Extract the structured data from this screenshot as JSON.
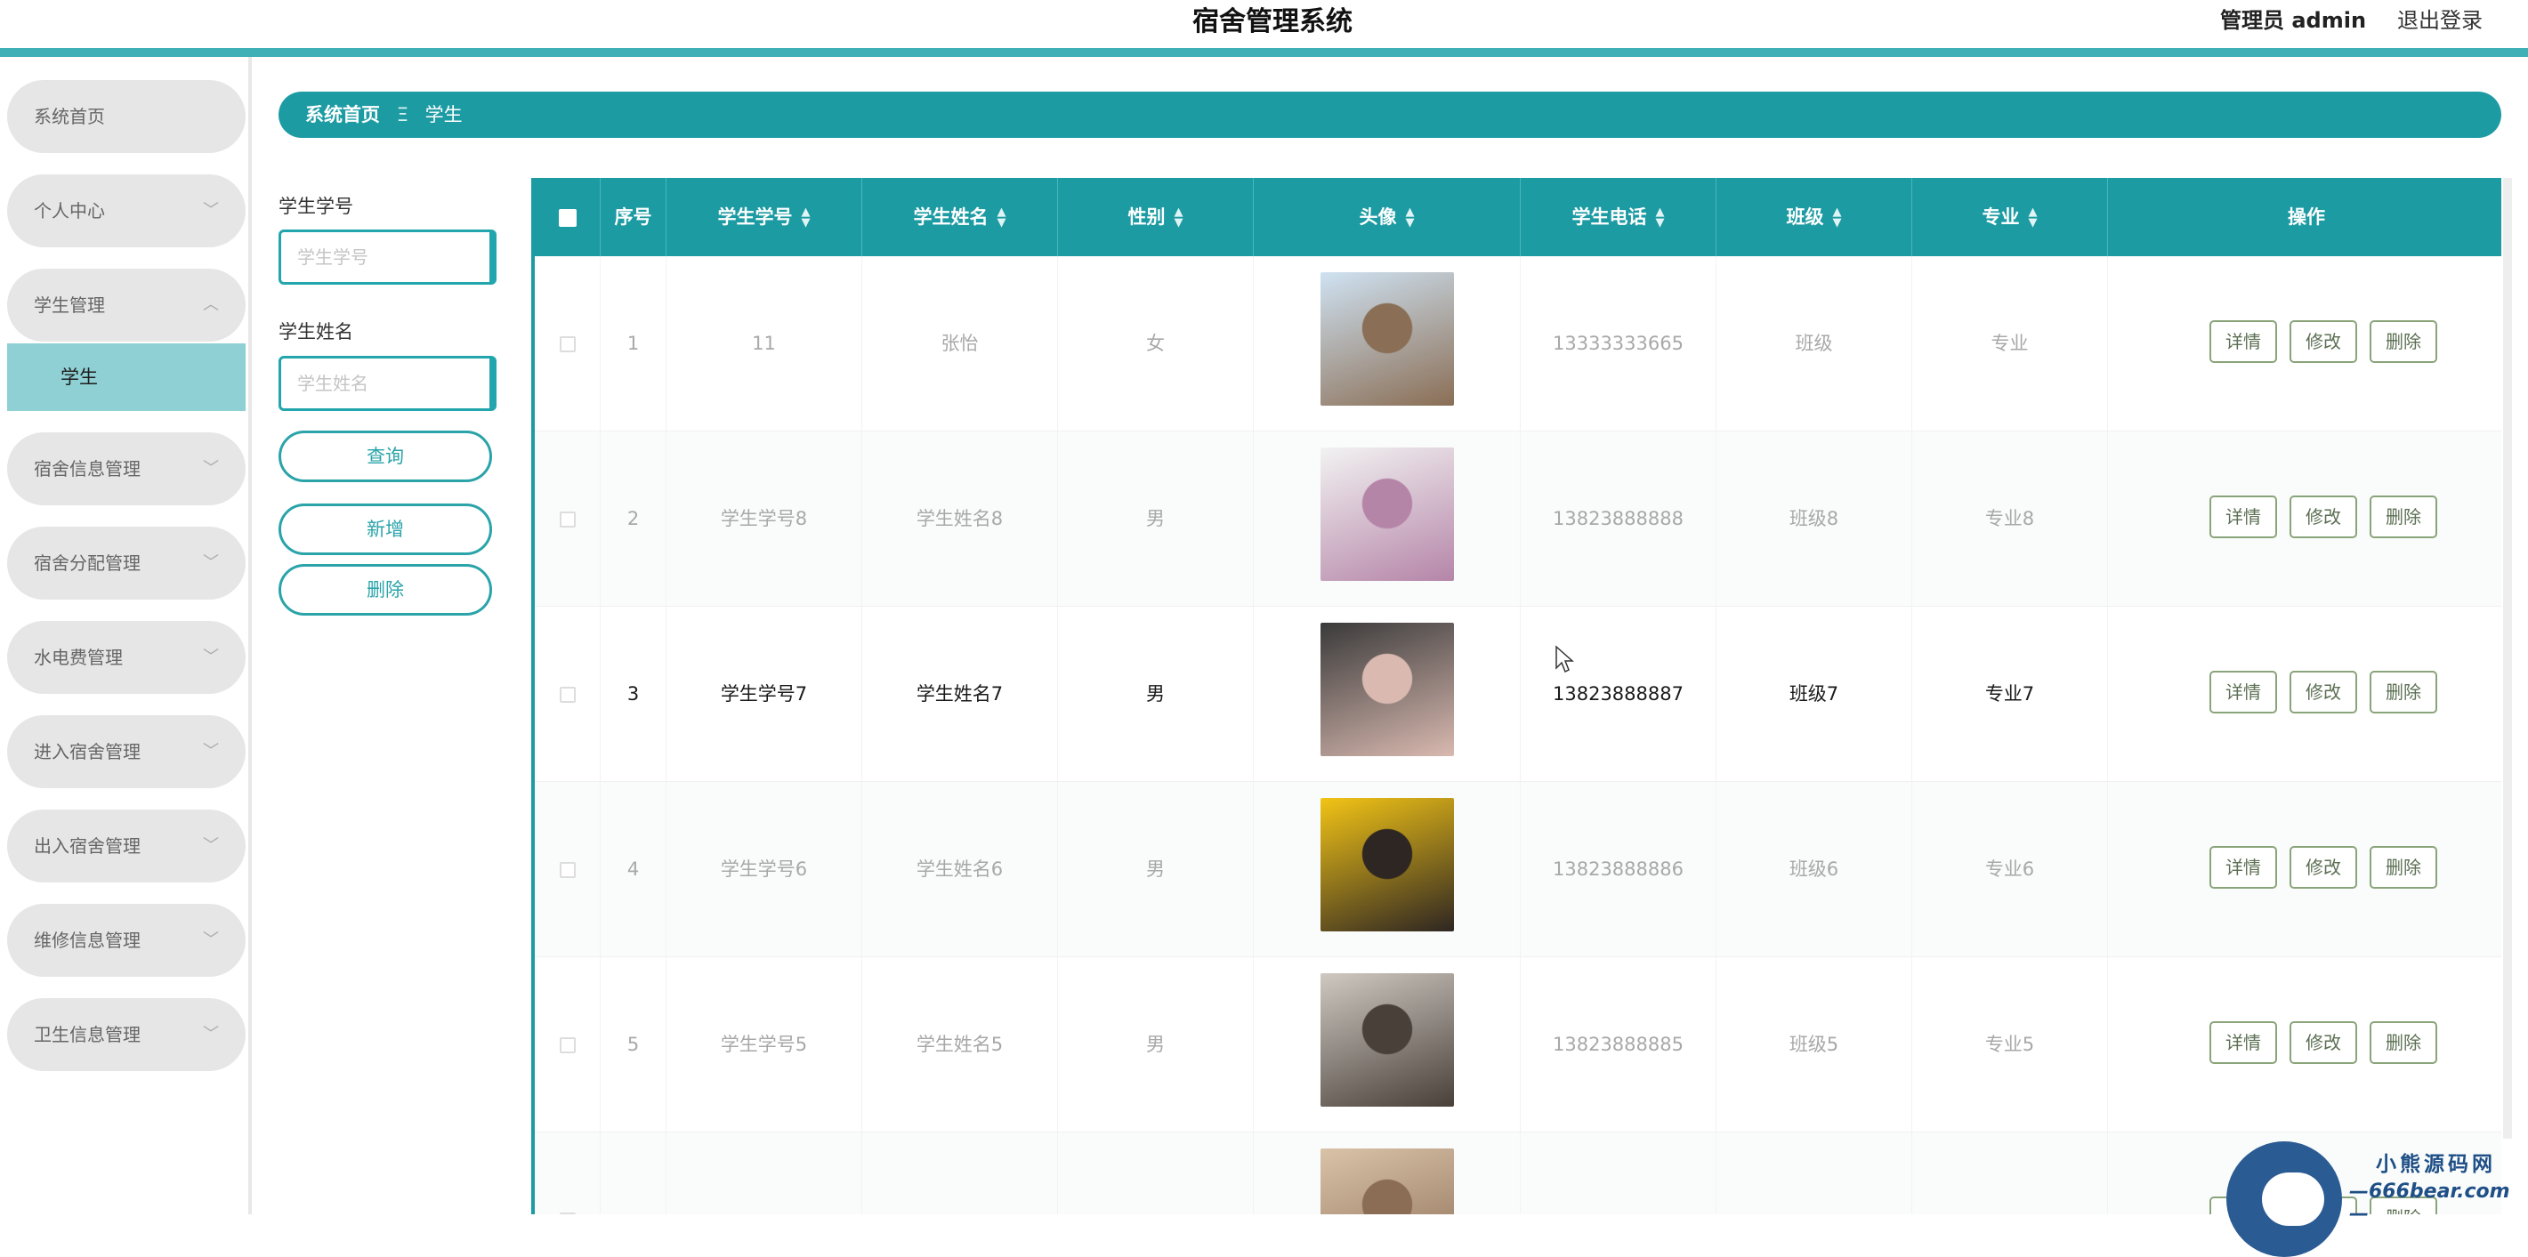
{
  "header": {
    "title": "宿舍管理系统",
    "admin": "管理员 admin",
    "logout": "退出登录"
  },
  "sidebar": {
    "items": [
      {
        "label": "系统首页",
        "chevron": ""
      },
      {
        "label": "个人中心",
        "chevron": "﹀"
      },
      {
        "label": "学生管理",
        "chevron": "︿"
      },
      {
        "label": "宿舍信息管理",
        "chevron": "﹀"
      },
      {
        "label": "宿舍分配管理",
        "chevron": "﹀"
      },
      {
        "label": "水电费管理",
        "chevron": "﹀"
      },
      {
        "label": "进入宿舍管理",
        "chevron": "﹀"
      },
      {
        "label": "出入宿舍管理",
        "chevron": "﹀"
      },
      {
        "label": "维修信息管理",
        "chevron": "﹀"
      },
      {
        "label": "卫生信息管理",
        "chevron": "﹀"
      }
    ],
    "active_sub": "学生"
  },
  "breadcrumb": {
    "home": "系统首页",
    "separator": "Ξ",
    "current": "学生"
  },
  "search": {
    "student_no_label": "学生学号",
    "student_no_placeholder": "学生学号",
    "student_name_label": "学生姓名",
    "student_name_placeholder": "学生姓名",
    "query": "查询",
    "add": "新增",
    "delete": "删除"
  },
  "table": {
    "columns": {
      "index": "序号",
      "student_no": "学生学号",
      "student_name": "学生姓名",
      "gender": "性别",
      "avatar": "头像",
      "phone": "学生电话",
      "class": "班级",
      "major": "专业",
      "actions": "操作"
    },
    "rows": [
      {
        "index": "1",
        "student_no": "11",
        "student_name": "张怡",
        "gender": "女",
        "phone": "13333333665",
        "class": "班级",
        "major": "专业",
        "avatar_colors": [
          "#cfe2f2",
          "#8a6e55"
        ]
      },
      {
        "index": "2",
        "student_no": "学生学号8",
        "student_name": "学生姓名8",
        "gender": "男",
        "phone": "13823888888",
        "class": "班级8",
        "major": "专业8",
        "avatar_colors": [
          "#f2f2f2",
          "#b585a8"
        ]
      },
      {
        "index": "3",
        "student_no": "学生学号7",
        "student_name": "学生姓名7",
        "gender": "男",
        "phone": "13823888887",
        "class": "班级7",
        "major": "专业7",
        "avatar_colors": [
          "#3a3a3a",
          "#d9b9b0"
        ]
      },
      {
        "index": "4",
        "student_no": "学生学号6",
        "student_name": "学生姓名6",
        "gender": "男",
        "phone": "13823888886",
        "class": "班级6",
        "major": "专业6",
        "avatar_colors": [
          "#f2c416",
          "#2e2622"
        ]
      },
      {
        "index": "5",
        "student_no": "学生学号5",
        "student_name": "学生姓名5",
        "gender": "男",
        "phone": "13823888885",
        "class": "班级5",
        "major": "专业5",
        "avatar_colors": [
          "#cfc9c2",
          "#4a403a"
        ]
      },
      {
        "index": "",
        "student_no": "",
        "student_name": "",
        "gender": "",
        "phone": "",
        "class": "",
        "major": "",
        "avatar_colors": [
          "#d9c3a8",
          "#8b6c55"
        ]
      }
    ],
    "actions": {
      "detail": "详情",
      "edit": "修改",
      "delete": "删除"
    }
  },
  "watermark": {
    "text": "小熊源码网",
    "url": "—666bear.com—"
  },
  "colors": {
    "primary": "#1c9ba3",
    "header_bar": "#3fb0b5",
    "active_sub": "#8fd0d4"
  }
}
